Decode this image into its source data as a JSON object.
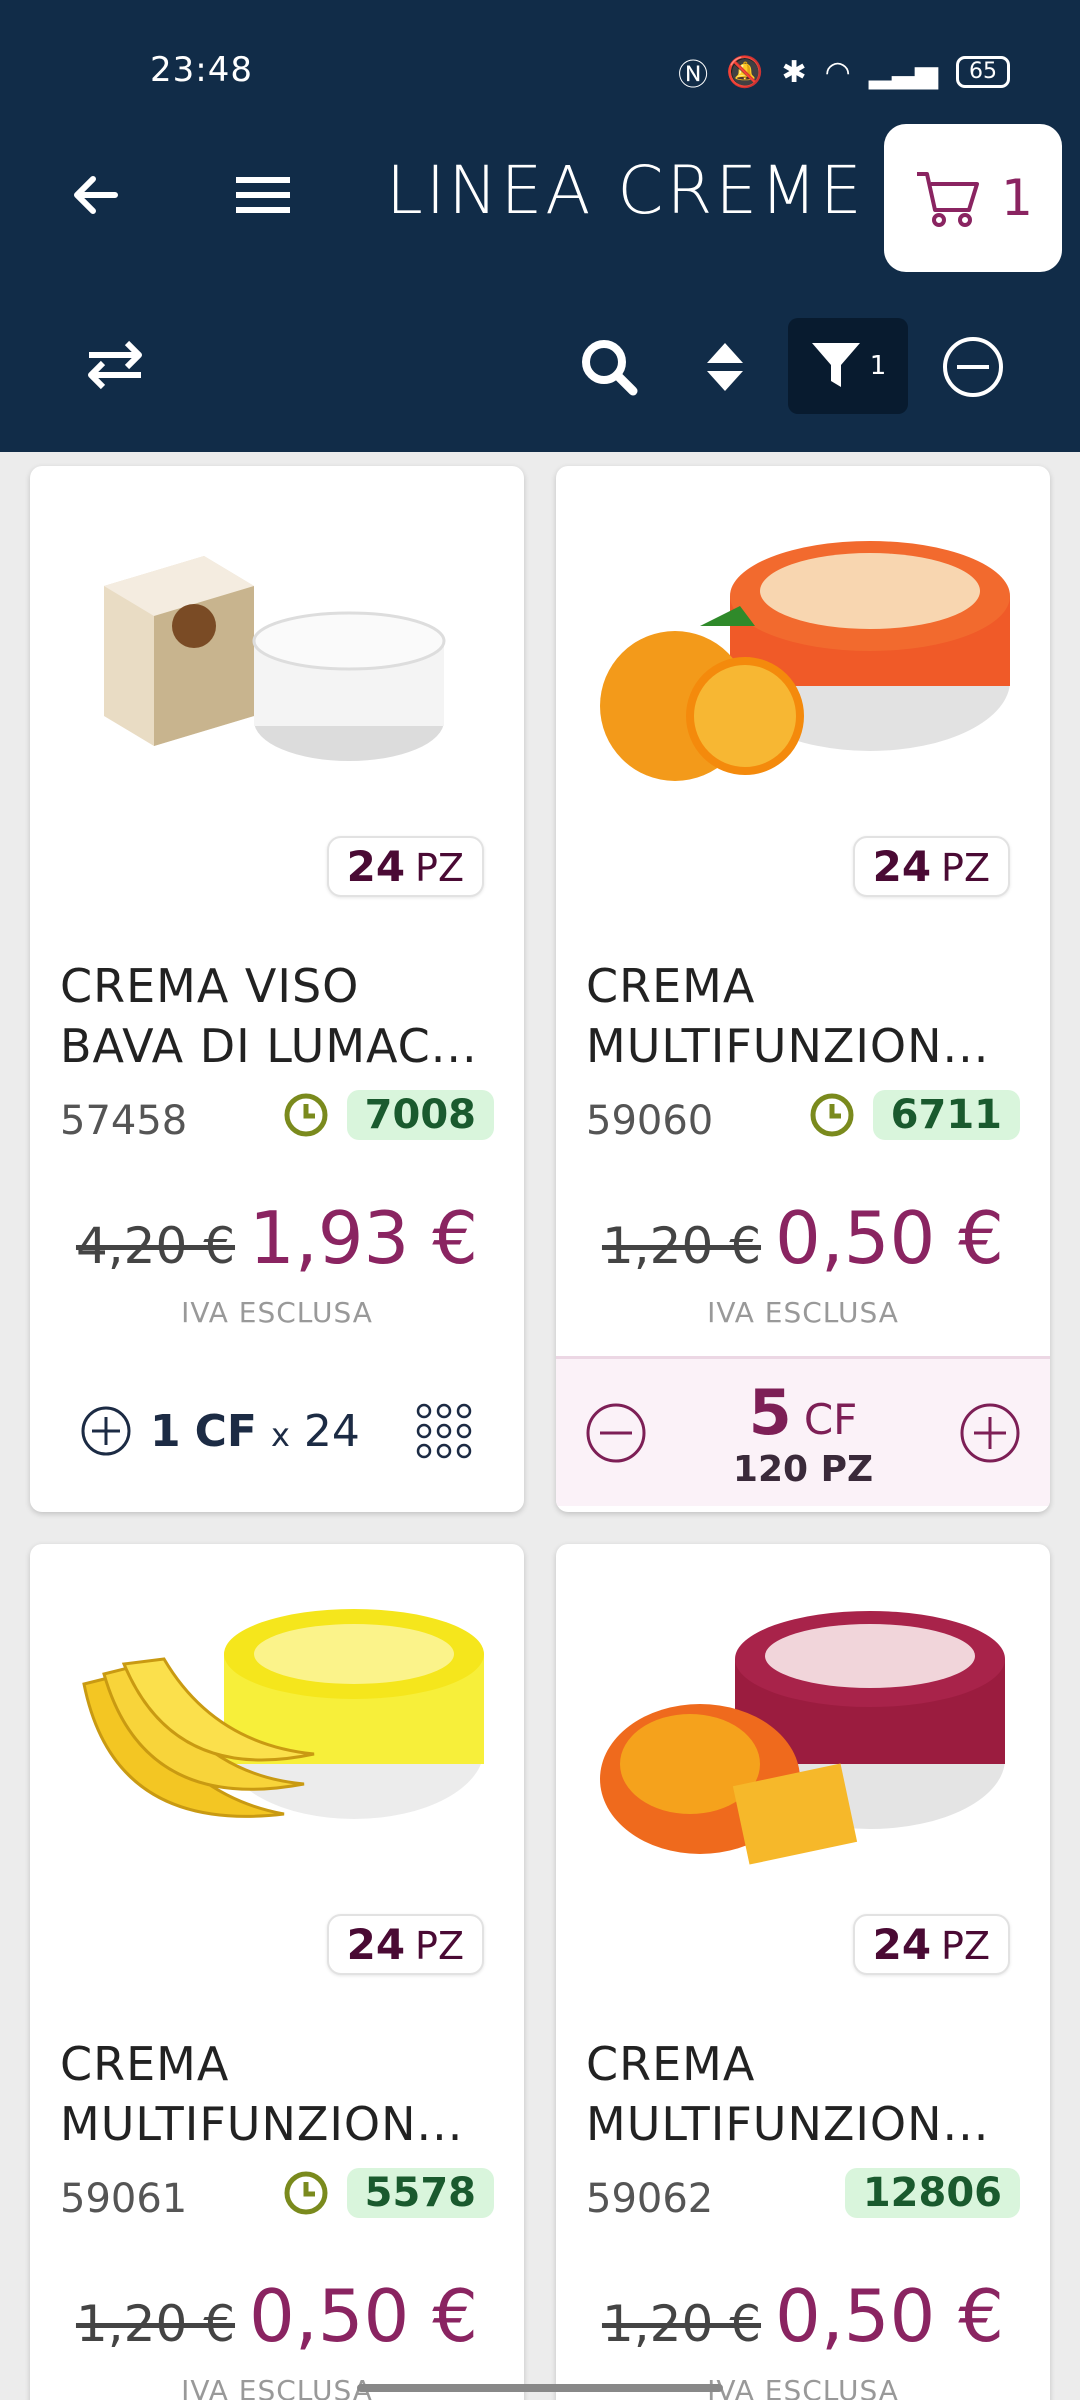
{
  "status_bar": {
    "time": "23:48",
    "battery": "65"
  },
  "header": {
    "title": "LINEA CREME",
    "cart_count": "1",
    "filter_count": "1"
  },
  "products": [
    {
      "name": "CREMA VISO",
      "name2": "BAVA DI LUMAC...",
      "pz_count": "24",
      "pz_unit": "PZ",
      "code": "57458",
      "stock": "7008",
      "old_price": "4,20 €",
      "new_price": "1,93 €",
      "vat": "IVA ESCLUSA",
      "qty": "1",
      "qty_unit": "CF",
      "times": "x",
      "pack": "24"
    },
    {
      "name": "CREMA",
      "name2": "MULTIFUNZION...",
      "pz_count": "24",
      "pz_unit": "PZ",
      "code": "59060",
      "stock": "6711",
      "old_price": "1,20 €",
      "new_price": "0,50 €",
      "vat": "IVA ESCLUSA",
      "qty": "5",
      "qty_unit": "CF",
      "qty_pz": "120 PZ"
    },
    {
      "name": "CREMA",
      "name2": "MULTIFUNZION...",
      "pz_count": "24",
      "pz_unit": "PZ",
      "code": "59061",
      "stock": "5578",
      "old_price": "1,20 €",
      "new_price": "0,50 €",
      "vat": "IVA ESCLUSA"
    },
    {
      "name": "CREMA",
      "name2": "MULTIFUNZION...",
      "pz_count": "24",
      "pz_unit": "PZ",
      "code": "59062",
      "stock": "12806",
      "old_price": "1,20 €",
      "new_price": "0,50 €",
      "vat": "IVA ESCLUSA"
    }
  ],
  "colors": {
    "header_bg": "#112c48",
    "accent": "#8a2461",
    "stock_bg": "#d9f5dc"
  }
}
